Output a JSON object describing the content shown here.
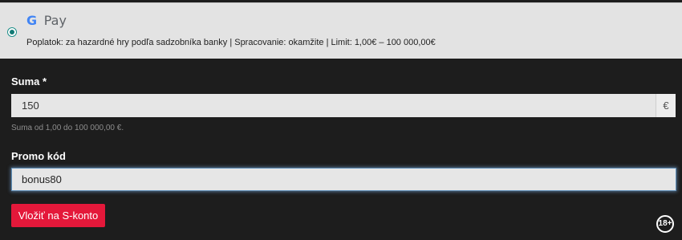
{
  "payment_method": {
    "brand_g": "G",
    "brand_pay": "Pay",
    "info": "Poplatok: za hazardné hry podľa sadzobníka banky | Spracovanie: okamžite | Limit: 1,00€ – 100 000,00€",
    "selected": true
  },
  "amount": {
    "label": "Suma *",
    "value": "150",
    "currency": "€",
    "hint": "Suma od 1,00 do 100 000,00 €."
  },
  "promo": {
    "label": "Promo kód",
    "value": "bonus80"
  },
  "submit_label": "Vložiť na S-konto",
  "age_badge": "18+",
  "colors": {
    "brand_red": "#e4183a",
    "radio_teal": "#127a75",
    "background": "#1d1d1d"
  }
}
